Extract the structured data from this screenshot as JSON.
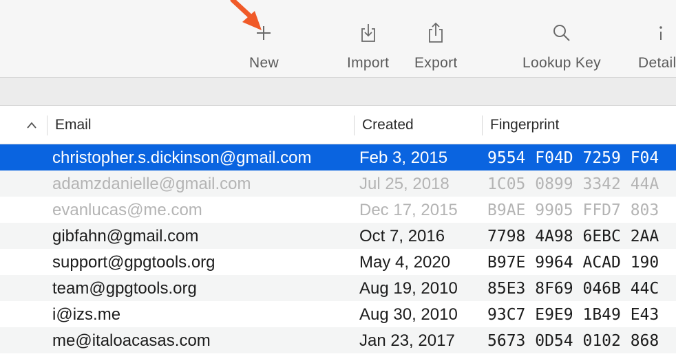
{
  "toolbar": {
    "buttons": [
      {
        "label": "New",
        "icon": "plus-icon"
      },
      {
        "label": "Import",
        "icon": "import-icon"
      },
      {
        "label": "Export",
        "icon": "export-icon"
      },
      {
        "label": "Lookup Key",
        "icon": "magnifier-icon"
      },
      {
        "label": "Details",
        "icon": "info-icon"
      }
    ]
  },
  "annotation": {
    "arrow_color": "#f05a28",
    "points_to": "New"
  },
  "table": {
    "columns": [
      "Email",
      "Created",
      "Fingerprint"
    ],
    "sort_indicator": "^",
    "rows": [
      {
        "email": "christopher.s.dickinson@gmail.com",
        "created": "Feb 3, 2015",
        "fingerprint": "9554 F04D 7259 F04",
        "state": "selected"
      },
      {
        "email": "adamzdanielle@gmail.com",
        "created": "Jul 25, 2018",
        "fingerprint": "1C05 0899 3342 44A",
        "state": "dimmed"
      },
      {
        "email": "evanlucas@me.com",
        "created": "Dec 17, 2015",
        "fingerprint": "B9AE 9905 FFD7 803",
        "state": "dimmed"
      },
      {
        "email": "gibfahn@gmail.com",
        "created": "Oct 7, 2016",
        "fingerprint": "7798 4A98 6EBC 2AA",
        "state": "normal"
      },
      {
        "email": "support@gpgtools.org",
        "created": "May 4, 2020",
        "fingerprint": "B97E 9964 ACAD 190",
        "state": "normal"
      },
      {
        "email": "team@gpgtools.org",
        "created": "Aug 19, 2010",
        "fingerprint": "85E3 8F69 046B 44C",
        "state": "normal"
      },
      {
        "email": "i@izs.me",
        "created": "Aug 30, 2010",
        "fingerprint": "93C7 E9E9 1B49 E43",
        "state": "normal"
      },
      {
        "email": "me@italoacasas.com",
        "created": "Jan 23, 2017",
        "fingerprint": "5673 0D54 0102 868",
        "state": "normal"
      }
    ]
  },
  "colors": {
    "selection": "#0a64e0",
    "arrow": "#f05a28"
  }
}
